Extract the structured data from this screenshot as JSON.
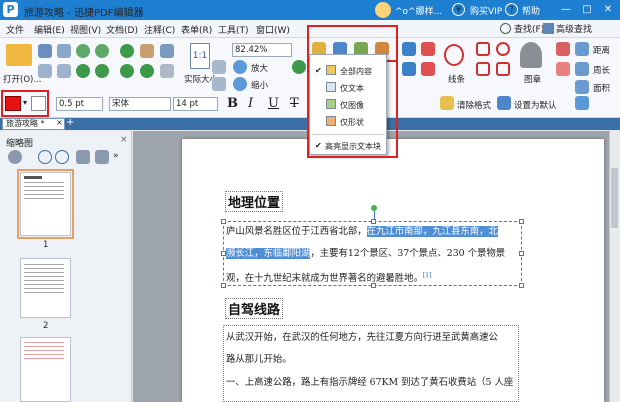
{
  "titlebar": {
    "app_title": "旅游攻略 - 迅捷PDF编辑器",
    "user_name": "^o^娜样...",
    "buy_vip": "购买VIP",
    "help": "帮助",
    "vip_symbol": "¥",
    "help_symbol": "?",
    "minimize": "—",
    "maximize": "□",
    "close": "✕"
  },
  "menu": {
    "items": [
      "文件",
      "编辑(E)",
      "视图(V)",
      "文档(D)",
      "注释(C)",
      "表单(R)",
      "工具(T)",
      "窗口(W)"
    ],
    "find": "查找(F)",
    "advanced_find": "高级查找"
  },
  "toolbar": {
    "open_label": "打开(O)...",
    "zoom_value": "82.42%",
    "actual_size": "实际大小",
    "zoom_in": "放大",
    "zoom_out": "缩小",
    "line_width": "0.5 pt",
    "font_name": "宋体",
    "font_size": "14 pt",
    "lines_label": "线条",
    "stamp_label": "图章",
    "distance_label": "距离",
    "perimeter_label": "周长",
    "area_label": "面积",
    "clear_format": "清除格式",
    "set_default": "设置为默认",
    "bold": "B",
    "italic": "I",
    "underline": "U",
    "strike": "T",
    "page_fit": "1:1"
  },
  "tab": {
    "doc_tab": "旅游攻略 *",
    "close": "×",
    "add": "+"
  },
  "sidebar": {
    "title": "缩略图",
    "close": "×",
    "page_labels": [
      "1",
      "2"
    ]
  },
  "dropdown": {
    "items": [
      "全部内容",
      "仅文本",
      "仅图像",
      "仅形状",
      "高亮显示文本块"
    ],
    "checked": "✔"
  },
  "document": {
    "heading1": "地理位置",
    "para1_line1_pre": "庐山风景名胜区位于江西省北部，",
    "para1_line1_hl": "在九江市南部，九江县东南，北",
    "para1_line2_hl": "濒长江，东临鄱阳湖",
    "para1_line2_post": "，主要有12个景区、37个景点、230 个景物景",
    "para1_line3": "观，在十九世纪末就成为世界著名的避暑胜地。",
    "footnote": "[1]",
    "heading2": "自驾线路",
    "para2_line1": "从武汉开始，在武汉的任何地方，先往江夏方向行进至武黄高速公",
    "para2_line2": "路从那儿开始。",
    "para2_line3": "一、上高速公路，路上有指示牌经 67KM 到达了黄石收费站（5 人座"
  },
  "colors": {
    "title_bar": "#1e7fd0",
    "highlight_box": "#e02020",
    "selection": "#4f8fd8",
    "red_text": "#d0202a"
  }
}
